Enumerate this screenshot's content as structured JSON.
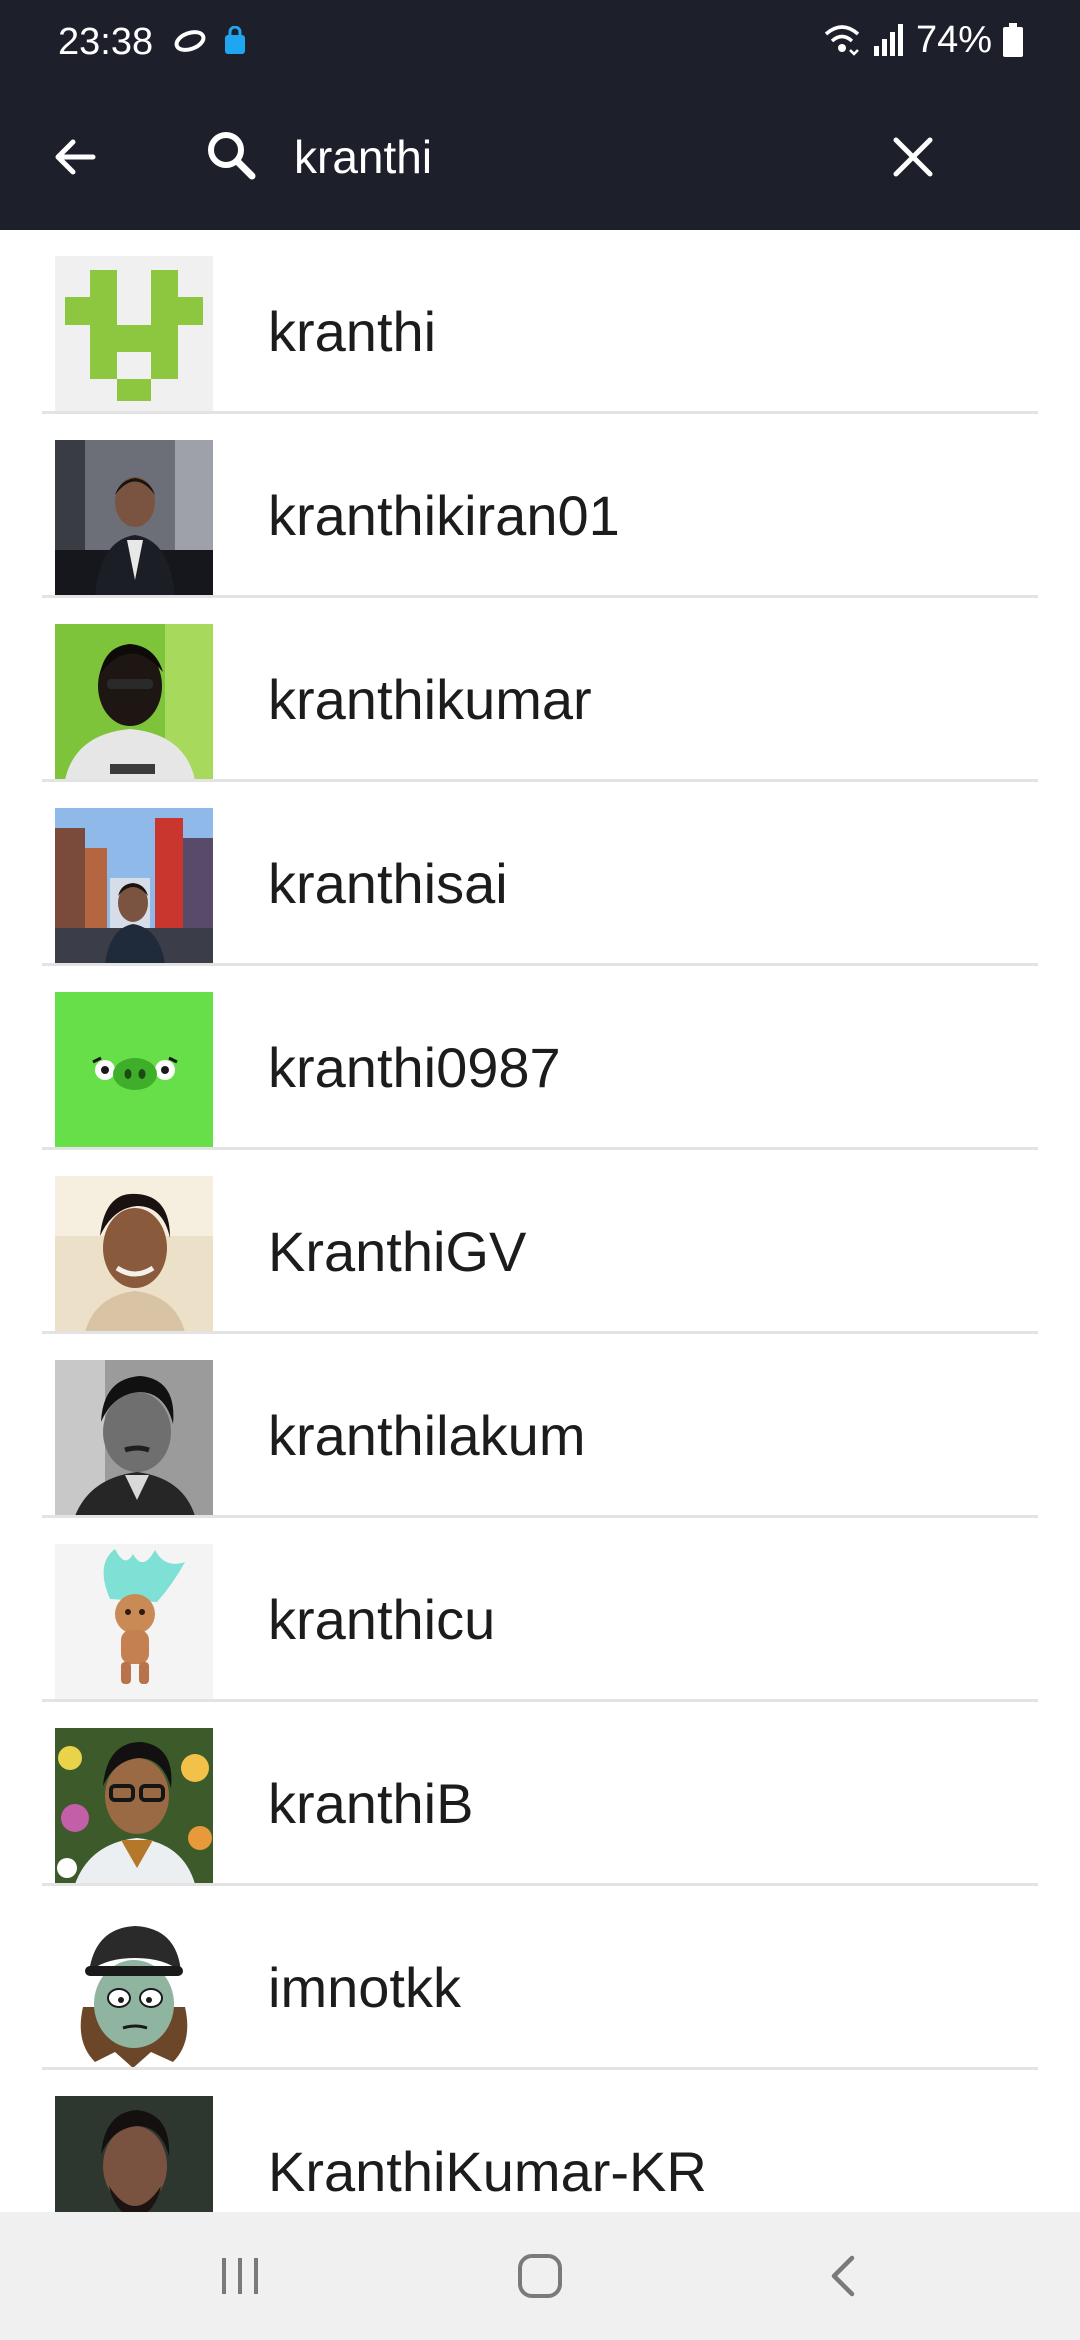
{
  "status_bar": {
    "time": "23:38",
    "battery": "74%"
  },
  "search": {
    "query": "kranthi",
    "placeholder": ""
  },
  "results": [
    {
      "username": "kranthi"
    },
    {
      "username": "kranthikiran01"
    },
    {
      "username": "kranthikumar"
    },
    {
      "username": "kranthisai"
    },
    {
      "username": "kranthi0987"
    },
    {
      "username": "KranthiGV"
    },
    {
      "username": "kranthilakum"
    },
    {
      "username": "kranthicu"
    },
    {
      "username": "kranthiB"
    },
    {
      "username": "imnotkk"
    },
    {
      "username": "KranthiKumar-KR"
    }
  ],
  "colors": {
    "app_bar": "#1d1f2b",
    "divider": "#e3e3e3",
    "nav_bar": "#f0f0f0"
  },
  "icons": {
    "back": "arrow-left-icon",
    "search": "search-icon",
    "clear": "close-icon"
  }
}
